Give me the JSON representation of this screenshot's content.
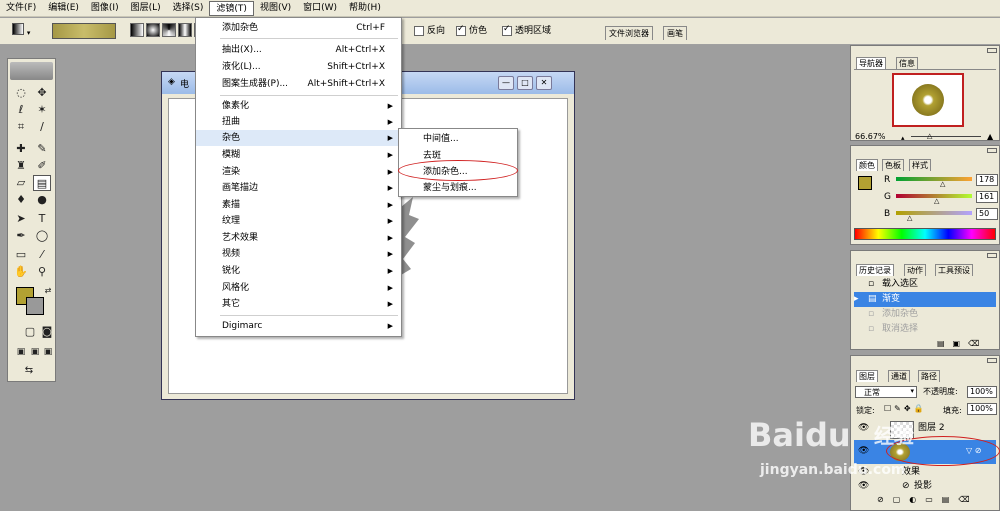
{
  "menubar": {
    "items": [
      "文件(F)",
      "编辑(E)",
      "图像(I)",
      "图层(L)",
      "选择(S)",
      "滤镜(T)",
      "视图(V)",
      "窗口(W)",
      "帮助(H)"
    ]
  },
  "options": {
    "reverse": "反向",
    "dither": "仿色",
    "transparency": "透明区域",
    "tab_file_browser": "文件浏览器",
    "tab_brushes": "画笔"
  },
  "doc": {
    "title": "电"
  },
  "filter_menu": {
    "last_filter": "添加杂色",
    "last_filter_shortcut": "Ctrl+F",
    "extract": "抽出(X)...",
    "extract_shortcut": "Alt+Ctrl+X",
    "liquify": "液化(L)...",
    "liquify_shortcut": "Shift+Ctrl+X",
    "pattern_maker": "图案生成器(P)...",
    "pattern_maker_shortcut": "Alt+Shift+Ctrl+X",
    "categories": [
      "像素化",
      "扭曲",
      "杂色",
      "模糊",
      "渲染",
      "画笔描边",
      "素描",
      "纹理",
      "艺术效果",
      "视频",
      "锐化",
      "风格化",
      "其它"
    ],
    "digimarc": "Digimarc"
  },
  "noise_submenu": {
    "items": [
      "中间值...",
      "去斑",
      "添加杂色...",
      "蒙尘与划痕..."
    ]
  },
  "navigator": {
    "tab_nav": "导航器",
    "tab_info": "信息",
    "zoom": "66.67%"
  },
  "color": {
    "tab_color": "颜色",
    "tab_swatches": "色板",
    "tab_styles": "样式",
    "r_label": "R",
    "g_label": "G",
    "b_label": "B",
    "r": "178",
    "g": "161",
    "b": "50",
    "fg_color": "#b2a132"
  },
  "history": {
    "tab_history": "历史记录",
    "tab_actions": "动作",
    "tab_presets": "工具预设",
    "items": [
      "载入选区",
      "渐变",
      "添加杂色",
      "取消选择"
    ]
  },
  "layers": {
    "tab_layers": "图层",
    "tab_channels": "通道",
    "tab_paths": "路径",
    "blend_mode": "正常",
    "opacity_label": "不透明度:",
    "opacity": "100%",
    "lock_label": "锁定:",
    "fill_label": "填充:",
    "fill": "100%",
    "layer_2": "图层 2",
    "effects": "效果",
    "drop_shadow": "投影"
  },
  "watermark": {
    "brand": "Baidu",
    "cn": "经验",
    "url": "jingyan.baidu.com"
  }
}
